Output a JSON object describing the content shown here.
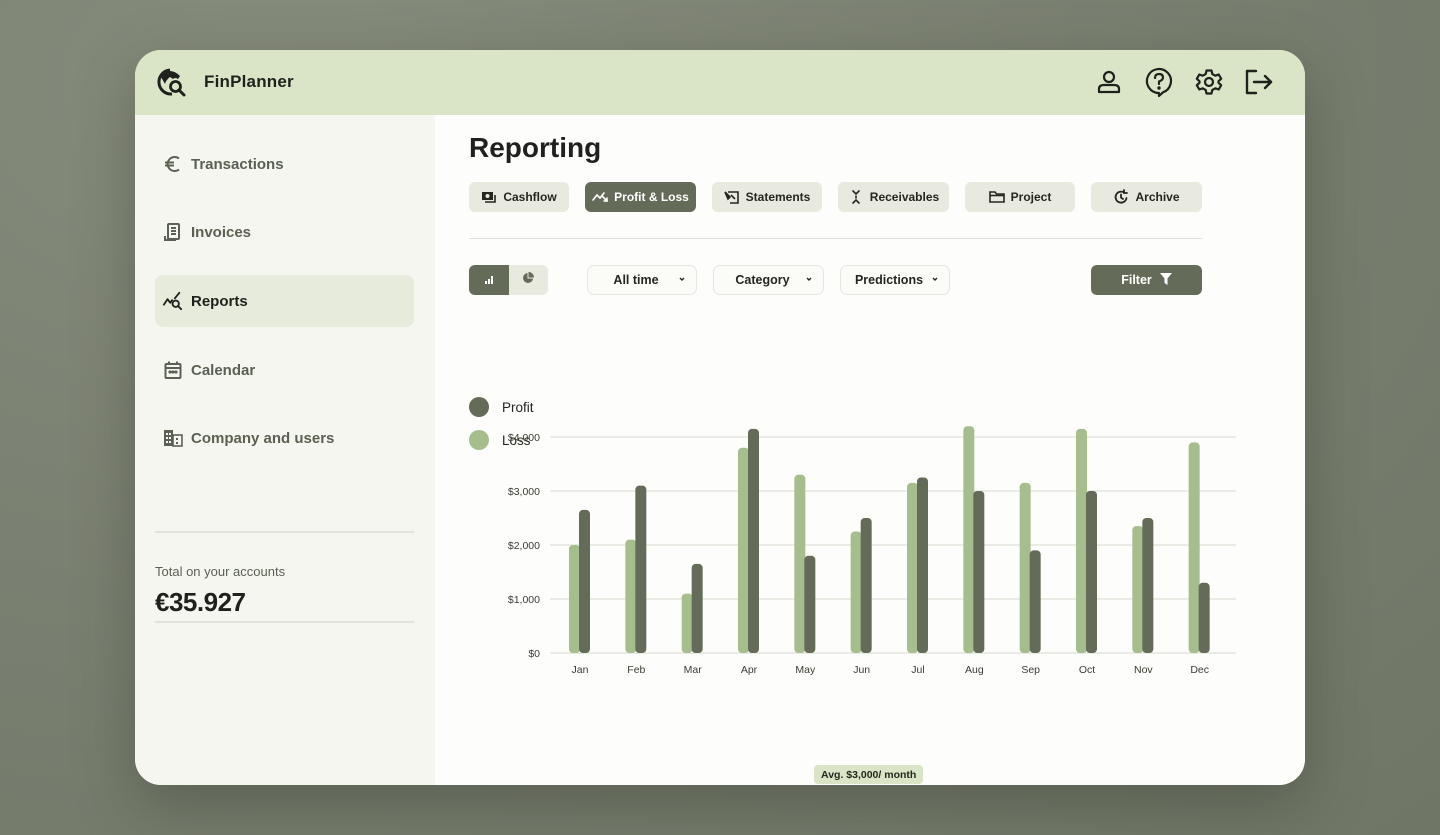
{
  "app": {
    "title": "FinPlanner",
    "logo_icon": "globe-search-icon",
    "top_icons": [
      "user-icon",
      "help-icon",
      "settings-icon",
      "logout-icon"
    ]
  },
  "sidebar": {
    "items": [
      {
        "label": "Transactions",
        "icon": "euro-icon",
        "active": false
      },
      {
        "label": "Invoices",
        "icon": "invoice-icon",
        "active": false
      },
      {
        "label": "Reports",
        "icon": "report-search-icon",
        "active": true
      },
      {
        "label": "Calendar",
        "icon": "calendar-icon",
        "active": false
      },
      {
        "label": "Company and users",
        "icon": "building-icon",
        "active": false
      }
    ],
    "total_label": "Total on your accounts",
    "total_value": "€35.927"
  },
  "main": {
    "title": "Reporting",
    "tabs": [
      {
        "label": "Cashflow",
        "icon": "cash-icon",
        "active": false
      },
      {
        "label": "Profit & Loss",
        "icon": "trend-icon",
        "active": true
      },
      {
        "label": "Statements",
        "icon": "statement-icon",
        "active": false
      },
      {
        "label": "Receivables",
        "icon": "collapse-icon",
        "active": false
      },
      {
        "label": "Project",
        "icon": "folder-icon",
        "active": false
      },
      {
        "label": "Archive",
        "icon": "history-icon",
        "active": false
      }
    ],
    "view_toggle": {
      "selected": "bar",
      "options": [
        "bar",
        "pie"
      ]
    },
    "filters": {
      "time": "All time",
      "category": "Category",
      "predictions": "Predictions",
      "filter_label": "Filter"
    },
    "avg_badge": "Avg. $3,000/ month"
  },
  "colors": {
    "profit": "#646b58",
    "loss": "#a6bd8e",
    "accent": "#646b58",
    "topbar": "#d9e5c6"
  },
  "chart_data": {
    "type": "bar",
    "title": "",
    "xlabel": "",
    "ylabel": "",
    "categories": [
      "Jan",
      "Feb",
      "Mar",
      "Apr",
      "May",
      "Jun",
      "Jul",
      "Aug",
      "Sep",
      "Oct",
      "Nov",
      "Dec"
    ],
    "series": [
      {
        "name": "Loss",
        "values": [
          2000,
          2100,
          1100,
          3800,
          3300,
          2250,
          3150,
          4200,
          3150,
          4150,
          2350,
          3900
        ]
      },
      {
        "name": "Profit",
        "values": [
          2650,
          3100,
          1650,
          4150,
          1800,
          2500,
          3250,
          3000,
          1900,
          3000,
          2500,
          1300
        ]
      }
    ],
    "legend": [
      {
        "name": "Profit"
      },
      {
        "name": "Loss"
      }
    ],
    "legend_position": "top-left",
    "ylim": [
      0,
      4000
    ],
    "yticks": [
      0,
      1000,
      2000,
      3000,
      4000
    ],
    "ytick_labels": [
      "$0",
      "$1,000",
      "$2,000",
      "$3,000",
      "$4,000"
    ],
    "grid": true,
    "annotation": "Avg. $3,000/ month"
  }
}
